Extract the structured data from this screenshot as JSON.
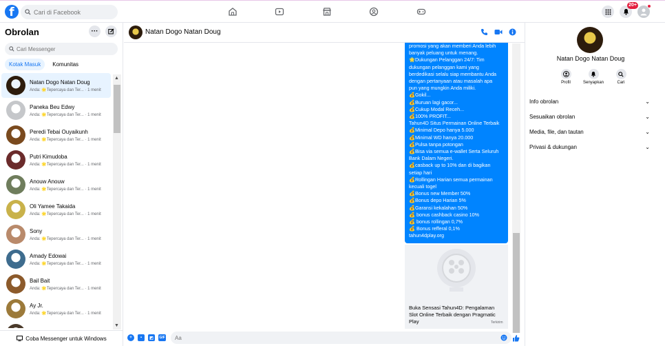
{
  "topbar": {
    "logo": "f",
    "search_placeholder": "Cari di Facebook",
    "notifications_badge": "20+"
  },
  "left": {
    "title": "Obrolan",
    "search_placeholder": "Cari Messenger",
    "tabs": [
      {
        "label": "Kotak Masuk",
        "active": true
      },
      {
        "label": "Komunitas",
        "active": false
      }
    ],
    "conversations": [
      {
        "name": "Natan Dogo Natan Doug",
        "preview": "Anda: 🌟Tepercaya dan Ter... · 1 menit",
        "color": "#2d1c0c",
        "selected": true
      },
      {
        "name": "Paneka Beu Edwy",
        "preview": "Anda: 🌟Tepercaya dan Ter... · 1 menit",
        "color": "#c5c7ca",
        "selected": false
      },
      {
        "name": "Peredi Tebai Ouyaikunh",
        "preview": "Anda: 🌟Tepercaya dan Ter... · 1 menit",
        "color": "#7a4a1e",
        "selected": false
      },
      {
        "name": "Putri Kimudoba",
        "preview": "Anda: 🌟Tepercaya dan Ter... · 1 menit",
        "color": "#6b2b2b",
        "selected": false
      },
      {
        "name": "Anouw Anouw",
        "preview": "Anda: 🌟Tepercaya dan Ter... · 1 menit",
        "color": "#6f7d5c",
        "selected": false
      },
      {
        "name": "Oli Yamee Takaida",
        "preview": "Anda: 🌟Tepercaya dan Ter... · 1 menit",
        "color": "#c9b24a",
        "selected": false
      },
      {
        "name": "Sony",
        "preview": "Anda: 🌟Tepercaya dan Ter... · 1 menit",
        "color": "#b98a6b",
        "selected": false
      },
      {
        "name": "Amady Edowai",
        "preview": "Anda: 🌟Tepercaya dan Ter... · 1 menit",
        "color": "#3e6c8e",
        "selected": false
      },
      {
        "name": "Bail Bait",
        "preview": "Anda: 🌟Tepercaya dan Ter... · 1 menit",
        "color": "#8c5a2b",
        "selected": false
      },
      {
        "name": "Ay Jr.",
        "preview": "Anda: 🌟Tepercaya dan Ter... · 1 menit",
        "color": "#9c7a3a",
        "selected": false
      },
      {
        "name": "",
        "preview": "",
        "color": "#4a3a2a",
        "selected": false
      }
    ],
    "bottom_link": "Coba Messenger untuk Windows"
  },
  "chat": {
    "name": "Natan Dogo Natan Doug",
    "message_lines": [
      "promosi yang akan memberi Anda lebih",
      "banyak peluang untuk menang.",
      "🌟Dukungan Pelanggan 24/7: Tim",
      "dukungan pelanggan kami yang",
      "berdedikasi selalu siap membantu Anda",
      "dengan pertanyaan atau masalah apa",
      "pun yang mungkin Anda miliki.",
      "💰Gokil...",
      "💰Buruan lagi gacor...",
      "💰Cukup Modal Receh...",
      "💰100% PROFIT...",
      "Tahun4D Situs Permainan Online Terbaik",
      "💰Minimal Depo hanya 5.000",
      "💰Minimal WD hanya 20.000",
      "💰Pulsa tanpa potongan",
      "💰Bisa via semua e-wallet Serta Seluruh",
      "Bank Dalam Negeri.",
      "💰casback up to 10% dan di bagikan",
      "setiap hari",
      "💰Rollingan Harian semua permainan",
      "kecuali togel",
      "💰Bonus new Member 50%",
      "💰Bonus depo Harian 5%",
      "💰Garansi kekalahan 50%",
      "💰 bonus cashback casino 10%",
      "💰 bonus rollingan 0,7%",
      "💰 Bonus refferal 0,1%",
      "tahun4dplay.org"
    ],
    "link_card_title": "Buka Sensasi Tahun4D: Pengalaman Slot Online Terbaik dengan Pragmatic Play",
    "sent_status": "Terkirim",
    "composer_placeholder": "Aa"
  },
  "right": {
    "name": "Natan Dogo Natan Doug",
    "actions": [
      {
        "label": "Profil",
        "icon": "profile-icon"
      },
      {
        "label": "Senyapkan",
        "icon": "bell-icon"
      },
      {
        "label": "Cari",
        "icon": "search-icon"
      }
    ],
    "menu": [
      "Info obrolan",
      "Sesuaikan obrolan",
      "Media, file, dan tautan",
      "Privasi & dukungan"
    ]
  },
  "colors": {
    "accent": "#1877f2",
    "bubble": "#0084ff",
    "badge": "#e41e3f"
  }
}
